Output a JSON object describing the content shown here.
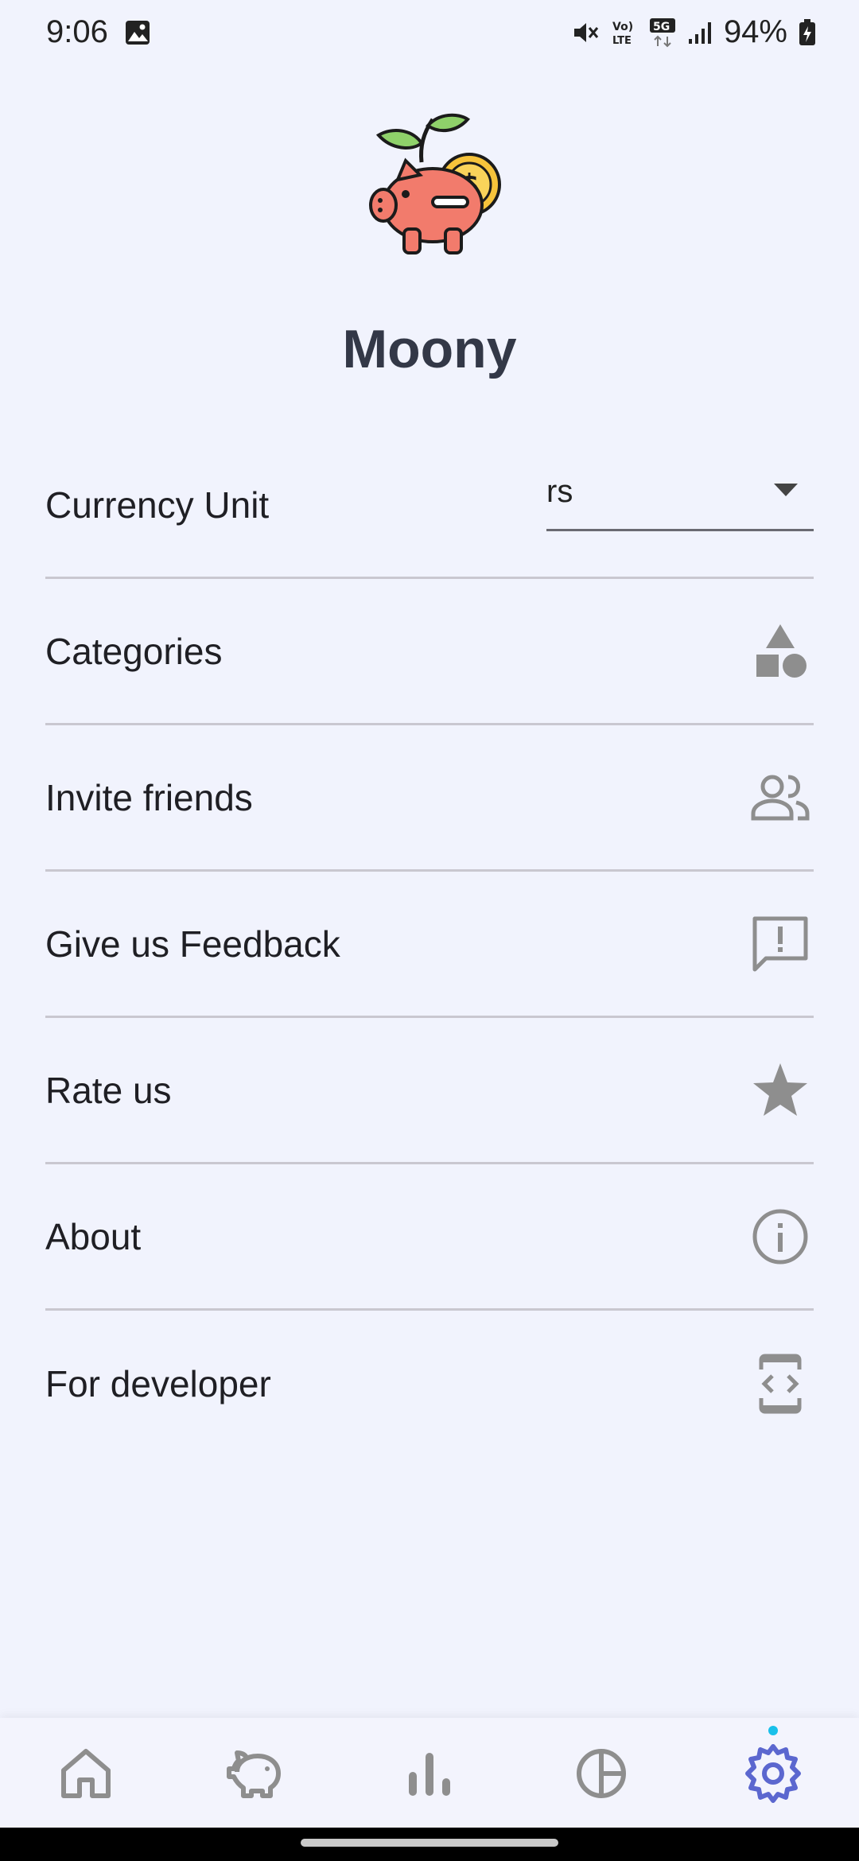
{
  "status_bar": {
    "time": "9:06",
    "battery": "94%",
    "network_label": "5G",
    "volte_label": "Vo) LTE"
  },
  "app": {
    "name": "Moony",
    "logo": "piggy-bank-plant-coin-logo"
  },
  "settings": {
    "currency": {
      "label": "Currency Unit",
      "value": "rs"
    },
    "categories": {
      "label": "Categories",
      "icon": "shapes-icon"
    },
    "invite": {
      "label": "Invite friends",
      "icon": "people-icon"
    },
    "feedback": {
      "label": "Give us Feedback",
      "icon": "feedback-icon"
    },
    "rate": {
      "label": "Rate us",
      "icon": "star-icon"
    },
    "about": {
      "label": "About",
      "icon": "info-icon"
    },
    "developer": {
      "label": "For developer",
      "icon": "developer-mode-icon"
    }
  },
  "bottom_nav": {
    "items": [
      {
        "name": "home",
        "icon": "home-icon",
        "active": false
      },
      {
        "name": "savings",
        "icon": "piggy-bank-icon",
        "active": false
      },
      {
        "name": "stats",
        "icon": "bar-chart-icon",
        "active": false
      },
      {
        "name": "budget",
        "icon": "pie-chart-icon",
        "active": false
      },
      {
        "name": "settings",
        "icon": "gear-icon",
        "active": true
      }
    ]
  },
  "colors": {
    "background": "#f1f3fd",
    "title": "#333847",
    "icon_gray": "#8e8e8e",
    "active_nav": "#5b67cf",
    "divider": "#c9c7d0"
  }
}
